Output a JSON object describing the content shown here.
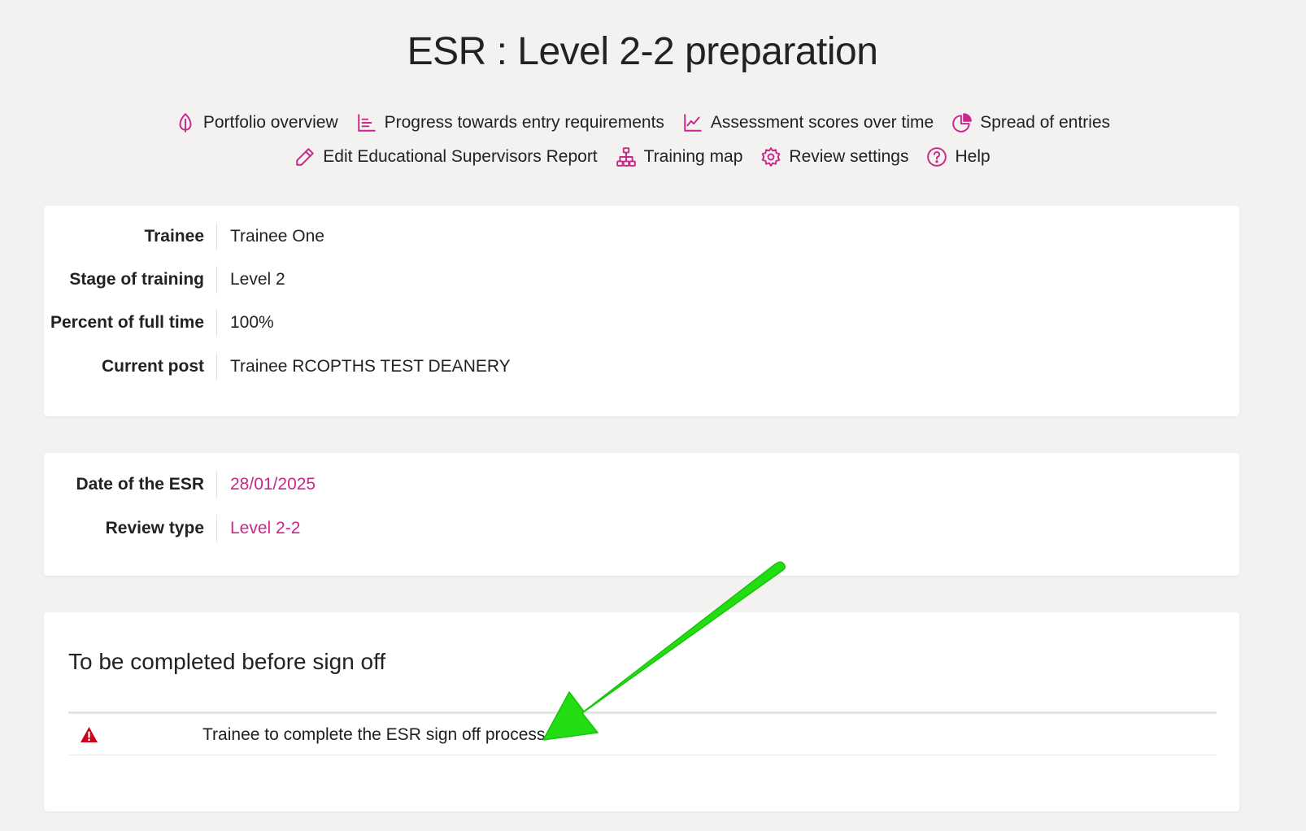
{
  "page": {
    "title": "ESR : Level 2-2 preparation"
  },
  "nav": {
    "row1": [
      {
        "label": "Portfolio overview",
        "icon": "leaf-icon"
      },
      {
        "label": "Progress towards entry requirements",
        "icon": "bar-list-icon"
      },
      {
        "label": "Assessment scores over time",
        "icon": "line-chart-icon"
      },
      {
        "label": "Spread of entries",
        "icon": "pie-chart-icon"
      }
    ],
    "row2": [
      {
        "label": "Edit Educational Supervisors Report",
        "icon": "pencil-icon"
      },
      {
        "label": "Training map",
        "icon": "sitemap-icon"
      },
      {
        "label": "Review settings",
        "icon": "gear-icon"
      },
      {
        "label": "Help",
        "icon": "question-circle-icon"
      }
    ]
  },
  "trainee_info": {
    "rows": [
      {
        "label": "Trainee",
        "value": "Trainee One"
      },
      {
        "label": "Stage of training",
        "value": "Level 2"
      },
      {
        "label": "Percent of full time",
        "value": "100%"
      },
      {
        "label": "Current post",
        "value": "Trainee RCOPTHS TEST DEANERY"
      }
    ]
  },
  "review_info": {
    "rows": [
      {
        "label": "Date of the ESR",
        "value": "28/01/2025"
      },
      {
        "label": "Review type",
        "value": "Level 2-2"
      }
    ]
  },
  "signoff": {
    "title": "To be completed before sign off",
    "tasks": [
      {
        "icon": "warning-icon",
        "text": "Trainee to complete the ESR sign off process"
      }
    ]
  },
  "colors": {
    "accent": "#c8288a",
    "warning": "#d0021b",
    "annotation_arrow": "#22dd11",
    "background": "#f3f2f1"
  }
}
